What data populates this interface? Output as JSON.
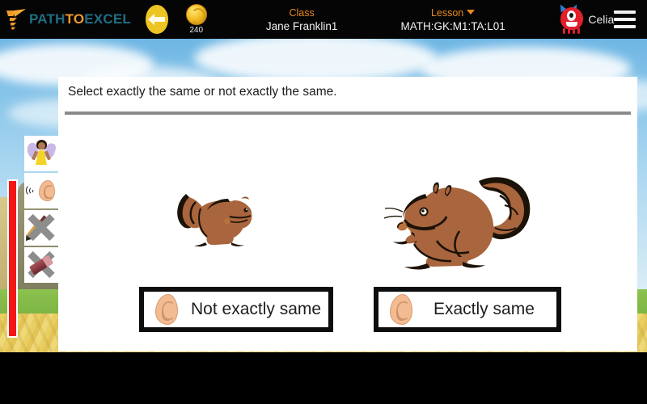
{
  "header": {
    "logo": {
      "part1": "PATH",
      "part2": "TO",
      "part3": "EXCEL",
      "icon": "checkmark-bird-logo"
    },
    "back_button_icon": "back-arrow-icon",
    "coin": {
      "icon": "gold-coin-icon",
      "count": "240"
    },
    "class": {
      "label": "Class",
      "value": "Jane Franklin1"
    },
    "lesson": {
      "label": "Lesson",
      "value": "MATH:GK:M1:TA:L01",
      "caret_icon": "chevron-down-icon"
    },
    "avatar_icon": "red-monster-avatar",
    "user_name": "Celia",
    "menu_icon": "hamburger-menu-icon"
  },
  "tools": {
    "fairy": {
      "icon": "fairy-helper-icon"
    },
    "listen": {
      "icon": "ear-listen-icon"
    },
    "pencil_disabled": {
      "icon": "pencil-disabled-icon"
    },
    "eraser_disabled": {
      "icon": "eraser-disabled-icon"
    }
  },
  "progress": {
    "icon": "vertical-progress-bar",
    "color": "#f21616"
  },
  "main": {
    "question": "Select exactly the same or not exactly the same.",
    "images": [
      {
        "name": "squirrel-small",
        "alt": "small brown squirrel facing right"
      },
      {
        "name": "squirrel-large",
        "alt": "large brown squirrel facing left"
      }
    ],
    "answers": [
      {
        "label": "Not exactly same",
        "icon": "ear-icon"
      },
      {
        "label": "Exactly same",
        "icon": "ear-icon"
      }
    ]
  },
  "colors": {
    "header_bg": "#050505",
    "logo_teal": "#1e6f84",
    "logo_orange": "#f0992c",
    "accent_orange": "#e8891e",
    "back_yellow": "#edc522",
    "progress_red": "#f21616",
    "panel_bg": "#ffffff"
  }
}
